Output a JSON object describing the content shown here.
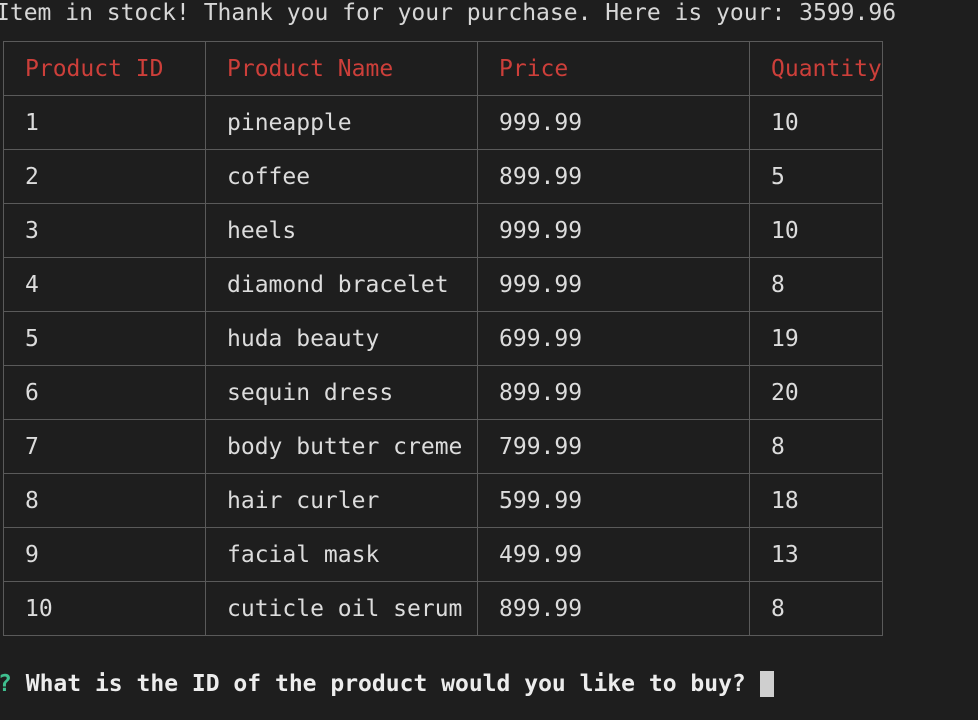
{
  "status_message": "Item in stock! Thank you for your purchase. Here is your: 3599.96",
  "table": {
    "headers": [
      "Product ID",
      "Product Name",
      "Price",
      "Quantity"
    ],
    "rows": [
      [
        "1",
        "pineapple",
        "999.99",
        "10"
      ],
      [
        "2",
        "coffee",
        "899.99",
        "5"
      ],
      [
        "3",
        "heels",
        "999.99",
        "10"
      ],
      [
        "4",
        "diamond bracelet",
        "999.99",
        "8"
      ],
      [
        "5",
        "huda beauty",
        "699.99",
        "19"
      ],
      [
        "6",
        "sequin dress",
        "899.99",
        "20"
      ],
      [
        "7",
        "body butter creme",
        "799.99",
        "8"
      ],
      [
        "8",
        "hair curler",
        "599.99",
        "18"
      ],
      [
        "9",
        "facial mask",
        "499.99",
        "13"
      ],
      [
        "10",
        "cuticle oil serum",
        "899.99",
        "8"
      ]
    ]
  },
  "prompt": {
    "mark": "?",
    "question": "What is the ID of the product would you like to buy?"
  },
  "colors": {
    "background": "#1e1e1e",
    "header_text": "#cd3f3a",
    "prompt_mark": "#3fbf8f",
    "border": "#5a5a5a"
  }
}
